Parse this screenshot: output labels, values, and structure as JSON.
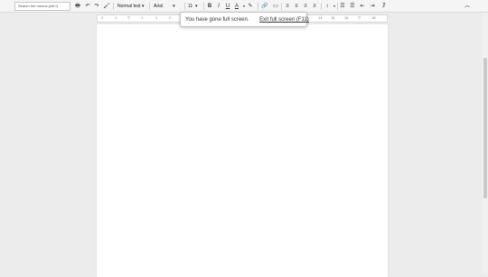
{
  "toolbar": {
    "search_placeholder": "Search the menus (Alt+/)",
    "style": "Normal text",
    "font": "Arial",
    "size": "11",
    "bold": "B",
    "italic": "I",
    "underline": "U",
    "text_color": "A"
  },
  "ruler": {
    "numbers": [
      "2",
      "1",
      "1",
      "1",
      "2",
      "3",
      "4",
      "5",
      "6",
      "7",
      "8",
      "9",
      "10",
      "11",
      "12",
      "13",
      "14",
      "15",
      "16",
      "17",
      "18"
    ]
  },
  "toast": {
    "message": "You have gone full screen.",
    "action": "Exit full screen (F11)"
  }
}
